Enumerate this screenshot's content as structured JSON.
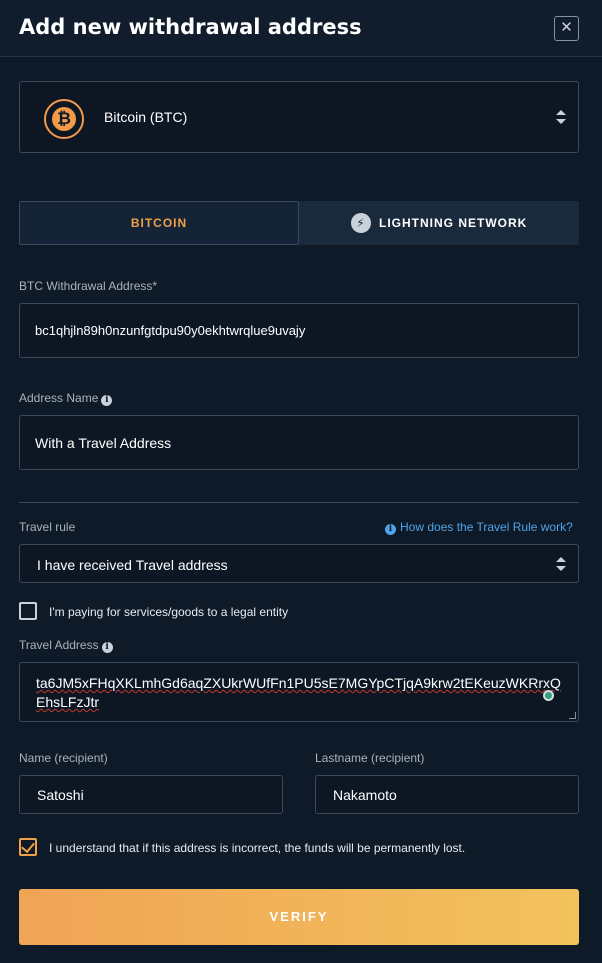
{
  "header": {
    "title": "Add new withdrawal address",
    "close_glyph": "✕"
  },
  "coin_select": {
    "symbol": "₿",
    "label": "Bitcoin (BTC)",
    "brand_color": "#f29a4a"
  },
  "network_tabs": [
    {
      "label": "BITCOIN",
      "active": true
    },
    {
      "label": "LIGHTNING NETWORK",
      "active": false,
      "icon": "lightning-bolt-icon"
    }
  ],
  "btc_address": {
    "label": "BTC Withdrawal Address*",
    "value": "bc1qhjln89h0nzunfgtdpu90y0ekhtwrqlue9uvajy"
  },
  "address_name": {
    "label": "Address Name",
    "value": "With a Travel Address"
  },
  "travel_rule": {
    "label": "Travel rule",
    "help_link": "How does the Travel Rule work?",
    "selected": "I have received Travel address"
  },
  "legal_entity": {
    "label": "I'm paying for services/goods to a legal entity",
    "checked": false
  },
  "travel_address": {
    "label": "Travel Address",
    "value": "ta6JM5xFHqXKLmhGd6aqZXUkrWUfFn1PU5sE7MGYpCTjqA9krw2tEKeuzWKRrxQEhsLFzJtr"
  },
  "recipient": {
    "name_label": "Name (recipient)",
    "name_value": "Satoshi",
    "lastname_label": "Lastname (recipient)",
    "lastname_value": "Nakamoto"
  },
  "acknowledge": {
    "label": "I understand that if this address is incorrect, the funds will be permanently lost.",
    "checked": true
  },
  "verify_button": {
    "label": "VERIFY"
  },
  "colors": {
    "background": "#0f1a28",
    "accent_orange": "#f0a048",
    "link_blue": "#4fa3e8",
    "button_gradient_start": "#f0a456",
    "button_gradient_end": "#f2c25c"
  }
}
